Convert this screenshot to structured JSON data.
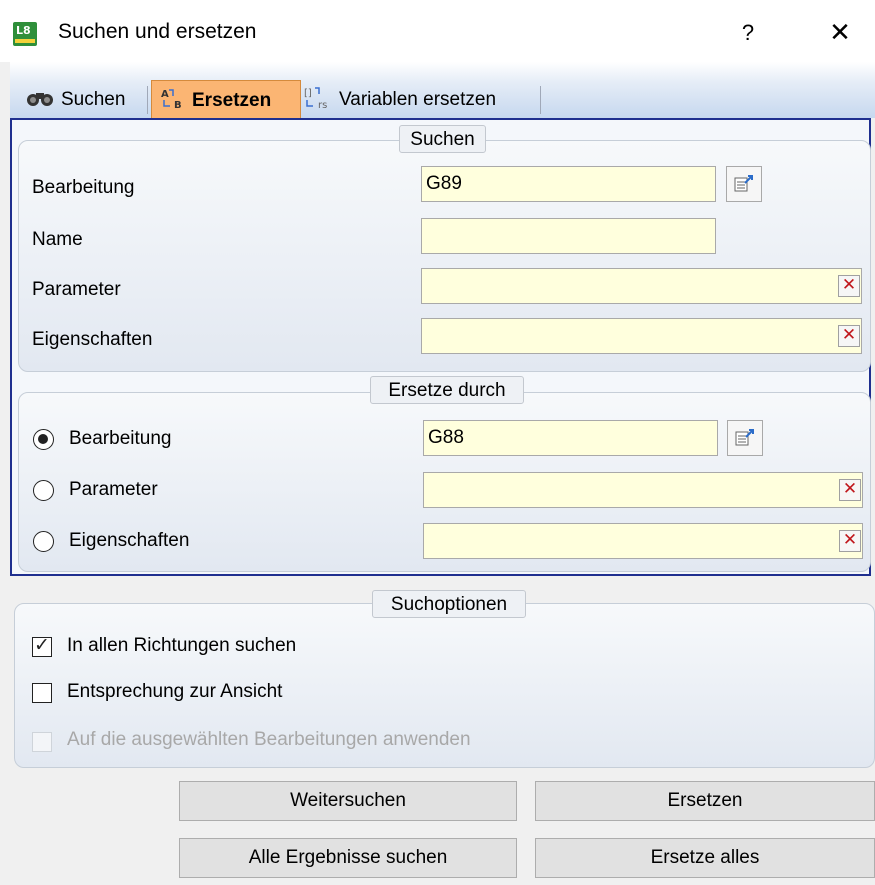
{
  "window": {
    "title": "Suchen und ersetzen",
    "help_label": "?",
    "close_label": "✕",
    "app_icon_text": "L8"
  },
  "tabs": [
    {
      "label": "Suchen",
      "icon": "binoculars-icon",
      "active": false
    },
    {
      "label": "Ersetzen",
      "icon": "replace-icon",
      "active": true
    },
    {
      "label": "Variablen ersetzen",
      "icon": "replace-variables-icon",
      "active": false
    }
  ],
  "search_group": {
    "title": "Suchen",
    "fields": [
      {
        "label": "Bearbeitung",
        "value": "G89"
      },
      {
        "label": "Name",
        "value": ""
      },
      {
        "label": "Parameter",
        "value": ""
      },
      {
        "label": "Eigenschaften",
        "value": ""
      }
    ]
  },
  "replace_group": {
    "title": "Ersetze durch",
    "options": [
      {
        "label": "Bearbeitung",
        "value": "G88",
        "selected": true
      },
      {
        "label": "Parameter",
        "value": "",
        "selected": false
      },
      {
        "label": "Eigenschaften",
        "value": "",
        "selected": false
      }
    ]
  },
  "options_group": {
    "title": "Suchoptionen",
    "checkboxes": [
      {
        "label": "In allen Richtungen suchen",
        "checked": true,
        "enabled": true
      },
      {
        "label": "Entsprechung zur Ansicht",
        "checked": false,
        "enabled": true
      },
      {
        "label": "Auf die ausgewählten Bearbeitungen anwenden",
        "checked": false,
        "enabled": false
      }
    ]
  },
  "buttons": {
    "find_next": "Weitersuchen",
    "replace": "Ersetzen",
    "find_all": "Alle Ergebnisse suchen",
    "replace_all": "Ersetze alles"
  },
  "colors": {
    "field_background": "#ffffdd",
    "active_tab": "#fbb573",
    "tab_page_border": "#1f2f8f",
    "clear_icon": "#c0161b"
  }
}
